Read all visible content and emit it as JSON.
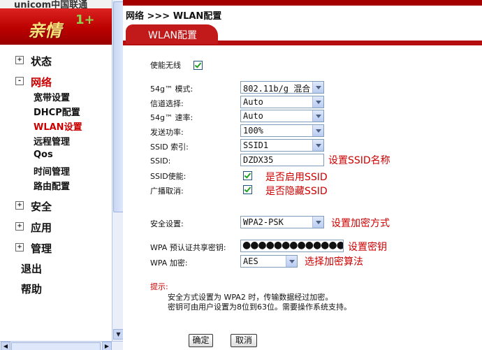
{
  "header": {
    "logo_text": "unicom中国联通",
    "brand_text": "亲情",
    "brand_mark": "1+"
  },
  "breadcrumb": "网络 >>> WLAN配置",
  "tab_title": "WLAN配置",
  "sidebar": {
    "items": [
      {
        "label": "状态",
        "box": "+",
        "level": "top"
      },
      {
        "label": "网络",
        "box": "-",
        "level": "top"
      },
      {
        "label": "宽带设置",
        "level": "sub"
      },
      {
        "label": "DHCP配置",
        "level": "sub"
      },
      {
        "label": "WLAN设置",
        "level": "sub",
        "selected": true
      },
      {
        "label": "远程管理",
        "level": "sub"
      },
      {
        "label": "Qos",
        "level": "sub"
      },
      {
        "label": "时间管理",
        "level": "sub"
      },
      {
        "label": "路由配置",
        "level": "sub"
      },
      {
        "label": "安全",
        "box": "+",
        "level": "top"
      },
      {
        "label": "应用",
        "box": "+",
        "level": "top"
      },
      {
        "label": "管理",
        "box": "+",
        "level": "top"
      },
      {
        "label": "退出",
        "level": "plain"
      },
      {
        "label": "帮助",
        "level": "plain"
      }
    ]
  },
  "form": {
    "enable_wireless_label": "使能无线",
    "enable_wireless_checked": true,
    "mode_label": "54g™ 模式:",
    "mode_value": "802.11b/g 混合",
    "channel_label": "信道选择:",
    "channel_value": "Auto",
    "rate_label": "54g™ 速率:",
    "rate_value": "Auto",
    "power_label": "发送功率:",
    "power_value": "100%",
    "ssid_index_label": "SSID 索引:",
    "ssid_index_value": "SSID1",
    "ssid_label": "SSID:",
    "ssid_value": "DZDX35",
    "ssid_enable_label": "SSID使能:",
    "ssid_enable_checked": true,
    "broadcast_cancel_label": "广播取消:",
    "broadcast_cancel_checked": true,
    "security_label": "安全设置:",
    "security_value": "WPA2-PSK",
    "psk_label": "WPA 预认证共享密钥:",
    "psk_value": "●●●●●●●●●●●●●",
    "wpa_enc_label": "WPA 加密:",
    "wpa_enc_value": "AES"
  },
  "annotations": {
    "ssid_name": "设置SSID名称",
    "ssid_enable": "是否启用SSID",
    "hide_ssid": "是否隐藏SSID",
    "encryption_method": "设置加密方式",
    "set_key": "设置密钥",
    "encryption_algo": "选择加密算法"
  },
  "tips": {
    "title": "提示:",
    "line1": "安全方式设置为 WPA2 时，传输数据经过加密。",
    "line2": "密钥可由用户设置为8位到63位。需要操作系统支持。"
  },
  "buttons": {
    "ok": "确定",
    "cancel": "取消"
  },
  "colors": {
    "brand_red": "#c21a1a",
    "annotation_red": "#cc0000",
    "selected_nav": "#cc0000"
  }
}
